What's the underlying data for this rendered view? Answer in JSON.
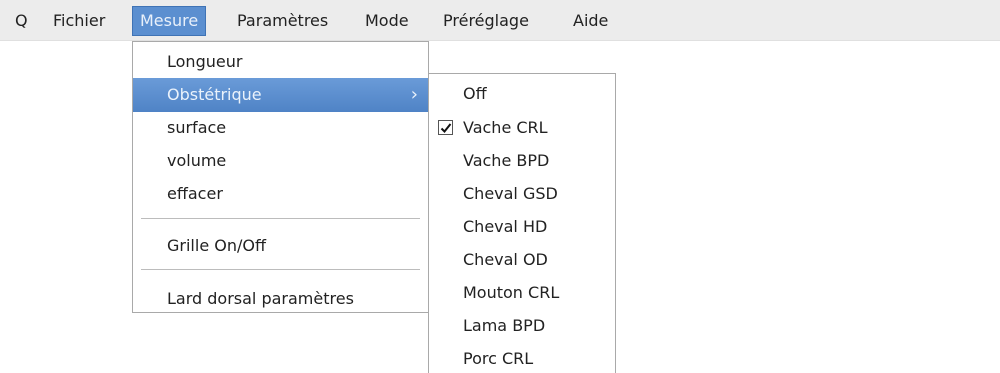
{
  "menubar": {
    "items": [
      "Q",
      "Fichier",
      "Mesure",
      "Paramètres",
      "Mode",
      "Préréglage",
      "Aide"
    ],
    "active_index": 2
  },
  "mesure_menu": {
    "items": [
      "Longueur",
      "Obstétrique",
      "surface",
      "volume",
      "effacer",
      "Grille On/Off",
      "Lard dorsal paramètres"
    ],
    "highlighted": "Obstétrique",
    "submenu_arrow": "›"
  },
  "obstetrique_submenu": {
    "items": [
      "Off",
      "Vache CRL",
      "Vache BPD",
      "Cheval GSD",
      "Cheval HD",
      "Cheval OD",
      "Mouton CRL",
      "Lama BPD",
      "Porc CRL"
    ],
    "checked": "Vache CRL"
  },
  "colors": {
    "highlight": "#5b8fd0",
    "menubar_bg": "#ececec"
  }
}
